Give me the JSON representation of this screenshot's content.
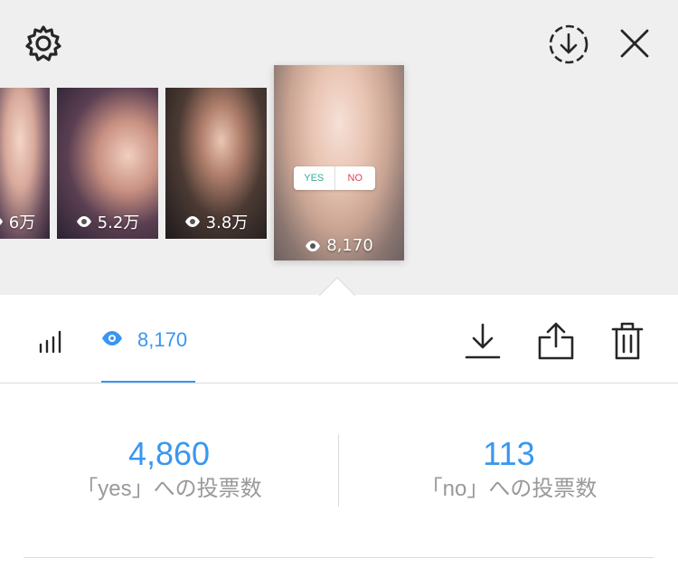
{
  "story_strip": {
    "thumbnails": [
      {
        "views": "6万",
        "selected": false
      },
      {
        "views": "5.2万",
        "selected": false
      },
      {
        "views": "3.8万",
        "selected": false
      },
      {
        "views": "8,170",
        "selected": true
      }
    ],
    "poll_sticker": {
      "yes_label": "YES",
      "no_label": "NO"
    }
  },
  "icons": {
    "settings": "gear-icon",
    "save_story": "download-circle-icon",
    "close": "close-icon",
    "insights": "bar-chart-icon",
    "viewers": "eye-icon",
    "download": "download-icon",
    "share": "share-icon",
    "delete": "trash-icon"
  },
  "tabs": {
    "viewers_count": "8,170"
  },
  "poll": {
    "yes": {
      "count": "4,860",
      "label": "「yes」への投票数"
    },
    "no": {
      "count": "113",
      "label": "「no」への投票数"
    }
  },
  "colors": {
    "accent": "#3897f0",
    "muted_text": "#999999",
    "divider": "#dbdbdb",
    "strip_bg": "#efefef"
  }
}
